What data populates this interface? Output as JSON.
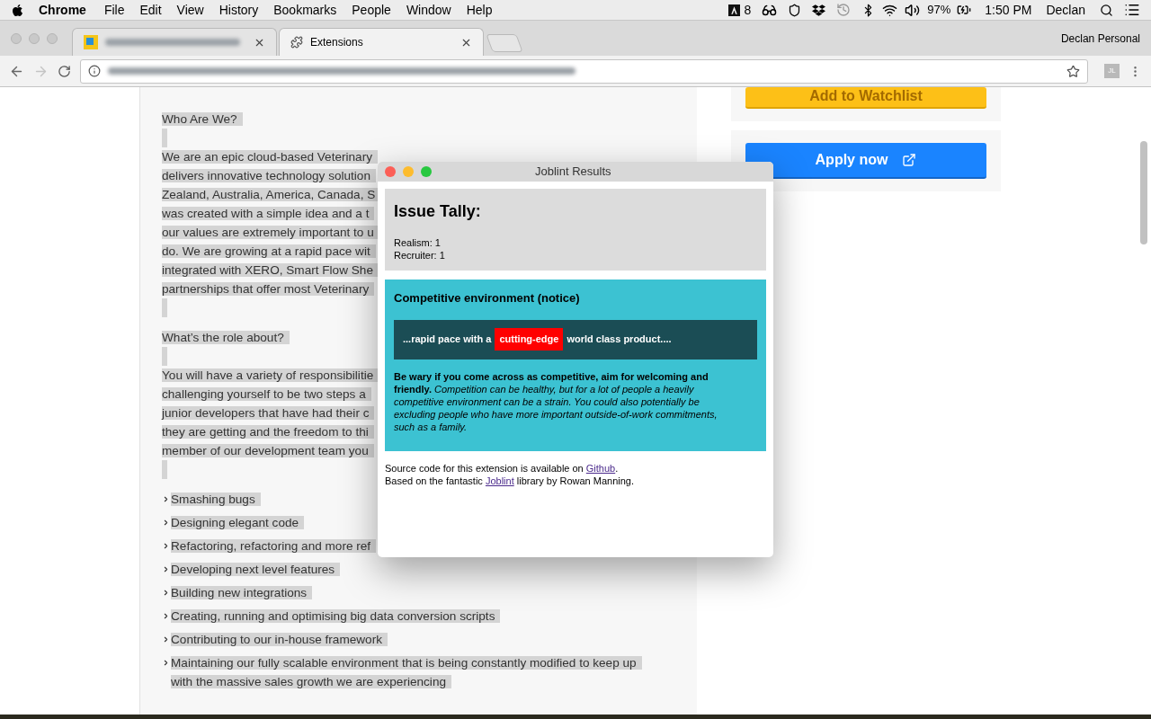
{
  "menu_bar": {
    "app": "Chrome",
    "items": [
      "File",
      "Edit",
      "View",
      "History",
      "Bookmarks",
      "People",
      "Window",
      "Help"
    ],
    "status": {
      "adobe_count": "8",
      "battery": "97%",
      "time": "1:50 PM",
      "user": "Declan"
    }
  },
  "tabs": [
    {
      "kind": "blurred",
      "selected": false
    },
    {
      "kind": "extension",
      "label": "Extensions",
      "selected": true
    }
  ],
  "profile": "Declan Personal",
  "toolbar": {
    "extension_badge": "JL"
  },
  "page": {
    "sections": [
      {
        "kind": "heading",
        "lines": [
          "Who Are We?"
        ]
      },
      {
        "kind": "paragraph",
        "lines": [
          "We are an epic cloud-based Veterinary",
          "delivers innovative technology solution",
          "Zealand, Australia, America, Canada, S",
          "was created with a simple idea and a t",
          "our values are extremely important to u",
          "do. We are growing at a rapid pace wit",
          "integrated with XERO, Smart Flow She",
          "partnerships that offer most Veterinary"
        ]
      },
      {
        "kind": "heading",
        "lines": [
          "What’s the role about?"
        ]
      },
      {
        "kind": "paragraph",
        "lines": [
          "You will have a variety of responsibilitie",
          "challenging yourself to be two steps a",
          "junior developers that have had their c",
          "they are getting and the freedom to thi",
          "member of our development team you"
        ]
      },
      {
        "kind": "list",
        "items": [
          [
            "Smashing bugs"
          ],
          [
            "Designing elegant code"
          ],
          [
            "Refactoring, refactoring and more ref"
          ],
          [
            "Developing next level features"
          ],
          [
            "Building new integrations"
          ],
          [
            "Creating, running and optimising big data conversion scripts"
          ],
          [
            "Contributing to our in-house framework"
          ],
          [
            "Maintaining our fully scalable environment that is being constantly modified to keep up",
            "with the massive sales growth we are experiencing"
          ]
        ]
      }
    ],
    "buttons": [
      {
        "kind": "watchlist",
        "label": "Add to Watchlist"
      },
      {
        "kind": "apply",
        "label": "Apply now"
      }
    ]
  },
  "popup": {
    "title": "Joblint Results",
    "tally": {
      "title": "Issue Tally:",
      "lines": [
        "Realism: 1",
        "Recruiter: 1"
      ]
    },
    "issues": [
      {
        "title": "Competitive environment (notice)",
        "snippet": {
          "before": "...rapid pace with a",
          "match": "cutting-edge",
          "after": "world class product...."
        },
        "description": "**Be wary if you come across as competitive, aim for welcoming and friendly.** *Competition can be healthy, but for a lot of people a heavily competitive environment can be a strain. You could also potentially be excluding people who have more important outside-of-work commitments, such as a family.*"
      }
    ],
    "footer": [
      {
        "before": "Source code for this extension is available on ",
        "link": "Github",
        "after": "."
      },
      {
        "before": "Based on the fantastic ",
        "link": "Joblint",
        "after": " library by Rowan Manning."
      }
    ]
  }
}
